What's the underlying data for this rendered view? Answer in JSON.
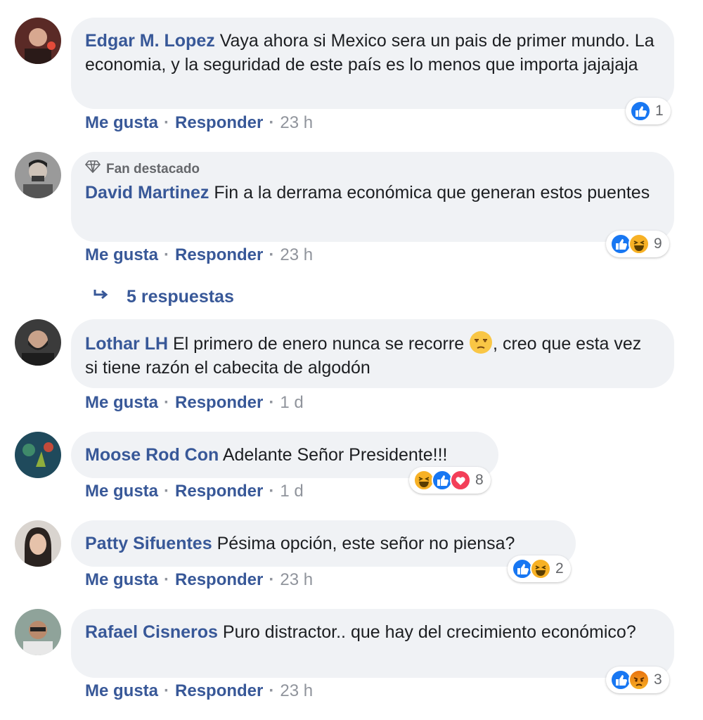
{
  "comments": [
    {
      "author": "Edgar M. Lopez",
      "text": "Vaya ahora si Mexico sera un pais de primer mundo. La economia, y la seguridad de este país es lo menos que importa jajajaja",
      "like": "Me gusta",
      "reply": "Responder",
      "time": "23 h",
      "reaction_count": "1",
      "reaction_icons": [
        "like-icon"
      ]
    },
    {
      "badge": "Fan destacado",
      "author": "David Martinez",
      "text": "Fin a la derrama económica que generan estos puentes",
      "like": "Me gusta",
      "reply": "Responder",
      "time": "23 h",
      "reaction_count": "9",
      "reaction_icons": [
        "like-icon",
        "haha-icon"
      ]
    },
    {
      "author": "Lothar LH",
      "text_before_emoji": "El primero de enero nunca se recorre ",
      "text_after_emoji": ", creo que esta vez si tiene razón el cabecita de algodón",
      "emoji": "unamused-face-icon",
      "like": "Me gusta",
      "reply": "Responder",
      "time": "1 d"
    },
    {
      "author": "Moose Rod Con",
      "text": "Adelante Señor Presidente!!!",
      "like": "Me gusta",
      "reply": "Responder",
      "time": "1 d",
      "reaction_count": "8",
      "reaction_icons": [
        "haha-icon",
        "like-icon",
        "love-icon"
      ]
    },
    {
      "author": "Patty Sifuentes",
      "text": "Pésima opción, este señor no piensa?",
      "like": "Me gusta",
      "reply": "Responder",
      "time": "23 h",
      "reaction_count": "2",
      "reaction_icons": [
        "like-icon",
        "haha-icon"
      ]
    },
    {
      "author": "Rafael Cisneros",
      "text": "Puro distractor.. que hay del crecimiento económico?",
      "like": "Me gusta",
      "reply": "Responder",
      "time": "23 h",
      "reaction_count": "3",
      "reaction_icons": [
        "like-icon",
        "angry-icon"
      ]
    }
  ],
  "replies_link": "5 respuestas",
  "colors": {
    "author": "#385898",
    "bubble": "#f0f2f5",
    "like_blue": "#1877f2",
    "love_red": "#f33e58",
    "haha_yellow": "#f7b125"
  }
}
